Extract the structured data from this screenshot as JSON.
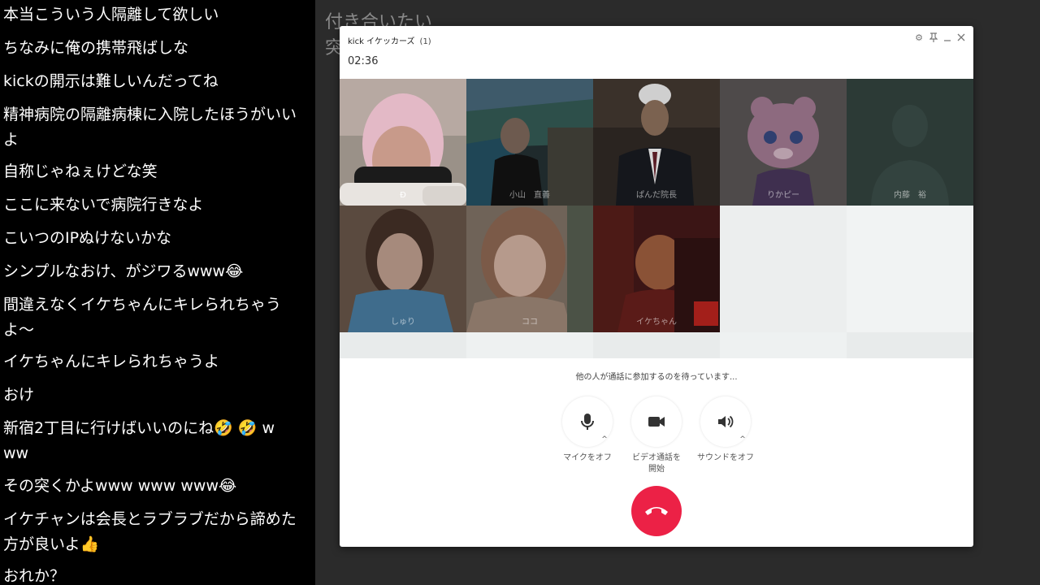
{
  "chat": {
    "messages": [
      "本当こういう人隔離して欲しい",
      "ちなみに俺の携帯飛ばしな",
      "kickの開示は難しいんだってね",
      "精神病院の隔離病棟に入院したほうがいいよ",
      "自称じゃねぇけどな笑",
      "ここに来ないで病院行きなよ",
      "こいつのIPぬけないかな",
      "シンプルなおけ、がジワるwww😂",
      "間違えなくイケちゃんにキレられちゃうよ〜",
      "イケちゃんにキレられちゃうよ",
      "おけ",
      "新宿2丁目に行けばいいのにね🤣 🤣 www",
      "その突くかよwww www www😂",
      "イケチャンは会長とラブラブだから諦めた方が良いよ👍",
      "おれか？"
    ]
  },
  "background": {
    "line1": "付き合いたい",
    "line2": "突"
  },
  "call": {
    "title": "kick イケッカーズ",
    "count": "(1)",
    "timer": "02:36",
    "participants": [
      {
        "name": "Đ"
      },
      {
        "name": "小山　直善"
      },
      {
        "name": "ぱんだ院長"
      },
      {
        "name": "りかピー"
      },
      {
        "name": "内藤　裕"
      },
      {
        "name": "しゅり"
      },
      {
        "name": "ココ"
      },
      {
        "name": "イケちゃん"
      }
    ],
    "waiting": "他の人が通話に参加するのを待っています...",
    "controls": {
      "mic": "マイクをオフ",
      "video_line1": "ビデオ通話を",
      "video_line2": "開始",
      "sound": "サウンドをオフ"
    },
    "icons": [
      "settings-icon",
      "pin-icon",
      "minimize-icon",
      "close-icon",
      "microphone-icon",
      "video-camera-icon",
      "speaker-icon",
      "hang-up-icon"
    ],
    "colors": {
      "hangup": "#ec2146"
    }
  }
}
